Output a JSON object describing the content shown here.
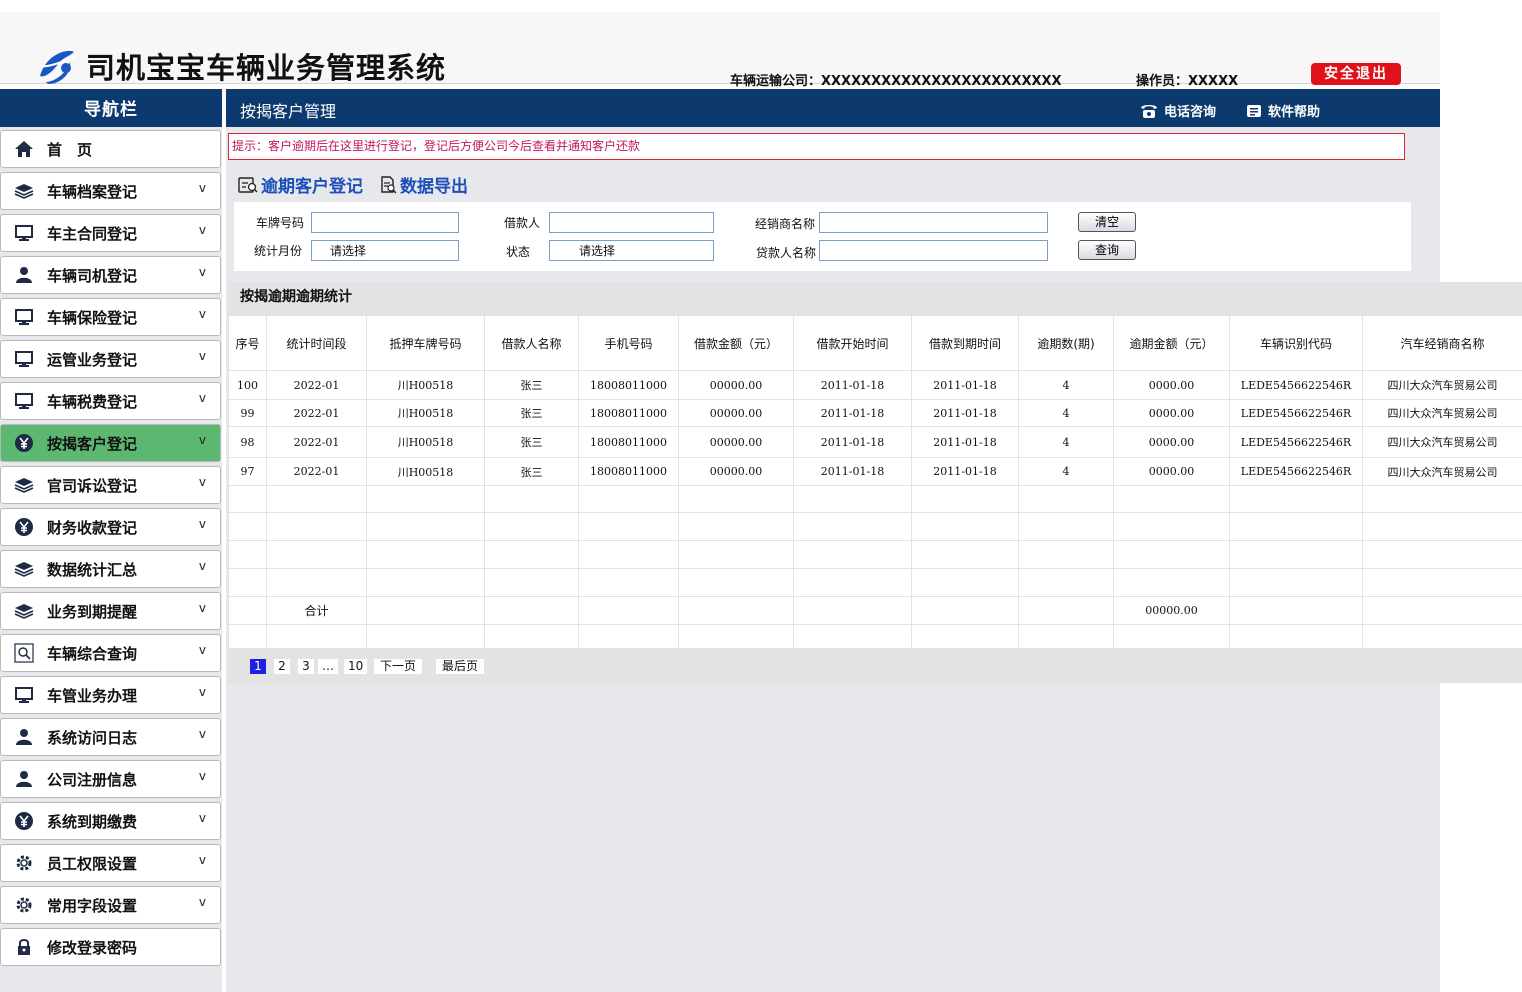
{
  "app": {
    "title": "司机宝宝车辆业务管理系统",
    "company": "车辆运输公司：XXXXXXXXXXXXXXXXXXXXXXXX",
    "operator": "操作员：XXXXX",
    "logout_label": "安全退出"
  },
  "sidebar": {
    "title": "导航栏",
    "items": [
      {
        "label": "首　页",
        "icon": "home-icon",
        "chevron": ""
      },
      {
        "label": "车辆档案登记",
        "icon": "layers-icon",
        "chevron": "v"
      },
      {
        "label": "车主合同登记",
        "icon": "monitor-icon",
        "chevron": "v"
      },
      {
        "label": "车辆司机登记",
        "icon": "user-icon",
        "chevron": "v"
      },
      {
        "label": "车辆保险登记",
        "icon": "monitor-icon",
        "chevron": "v"
      },
      {
        "label": "运管业务登记",
        "icon": "monitor-icon",
        "chevron": "v"
      },
      {
        "label": "车辆税费登记",
        "icon": "monitor-icon",
        "chevron": "v"
      },
      {
        "label": "按揭客户登记",
        "icon": "yen-icon",
        "chevron": "v"
      },
      {
        "label": "官司诉讼登记",
        "icon": "layers-icon",
        "chevron": "v"
      },
      {
        "label": "财务收款登记",
        "icon": "yen-icon",
        "chevron": "v"
      },
      {
        "label": "数据统计汇总",
        "icon": "layers-icon",
        "chevron": "v"
      },
      {
        "label": "业务到期提醒",
        "icon": "layers-icon",
        "chevron": "v"
      },
      {
        "label": "车辆综合查询",
        "icon": "search-icon",
        "chevron": "v"
      },
      {
        "label": "车管业务办理",
        "icon": "monitor-icon",
        "chevron": "v"
      },
      {
        "label": "系统访问日志",
        "icon": "user-icon",
        "chevron": "v"
      },
      {
        "label": "公司注册信息",
        "icon": "user-icon",
        "chevron": "v"
      },
      {
        "label": "系统到期缴费",
        "icon": "yen-icon",
        "chevron": "v"
      },
      {
        "label": "员工权限设置",
        "icon": "gear-icon",
        "chevron": "v"
      },
      {
        "label": "常用字段设置",
        "icon": "gear-icon",
        "chevron": "v"
      },
      {
        "label": "修改登录密码",
        "icon": "lock-icon",
        "chevron": ""
      }
    ],
    "active_index": 7,
    "active_color": "#5cb870"
  },
  "main": {
    "title": "按揭客户管理",
    "phone_label": "电话咨询",
    "help_label": "软件帮助",
    "hint": "提示：客户逾期后在这里进行登记，登记后方便公司今后查看并通知客户还款",
    "action_register": "逾期客户登记",
    "action_export": "数据导出"
  },
  "filter": {
    "plate_label": "车牌号码",
    "plate_value": "",
    "borrower_label": "借款人",
    "borrower_value": "",
    "dealer_label": "经销商名称",
    "dealer_value": "",
    "month_label": "统计月份",
    "month_value": "请选择",
    "status_label": "状态",
    "status_value": "请选择",
    "lender_label": "贷款人名称",
    "lender_value": "",
    "clear_label": "清空",
    "search_label": "查询"
  },
  "table": {
    "section_title": "按揭逾期逾期统计",
    "columns": [
      "序号",
      "统计时间段",
      "抵押车牌号码",
      "借款人名称",
      "手机号码",
      "借款金额（元）",
      "借款开始时间",
      "借款到期时间",
      "逾期数(期)",
      "逾期金额（元）",
      "车辆识别代码",
      "汽车经销商名称"
    ],
    "rows": [
      [
        "100",
        "2022-01",
        "川H00518",
        "张三",
        "18008011000",
        "00000.00",
        "2011-01-18",
        "2011-01-18",
        "4",
        "0000.00",
        "LEDE5456622546R",
        "四川大众汽车贸易公司"
      ],
      [
        "99",
        "2022-01",
        "川H00518",
        "张三",
        "18008011000",
        "00000.00",
        "2011-01-18",
        "2011-01-18",
        "4",
        "0000.00",
        "LEDE5456622546R",
        "四川大众汽车贸易公司"
      ],
      [
        "98",
        "2022-01",
        "川H00518",
        "张三",
        "18008011000",
        "00000.00",
        "2011-01-18",
        "2011-01-18",
        "4",
        "0000.00",
        "LEDE5456622546R",
        "四川大众汽车贸易公司"
      ],
      [
        "97",
        "2022-01",
        "川H00518",
        "张三",
        "18008011000",
        "00000.00",
        "2011-01-18",
        "2011-01-18",
        "4",
        "0000.00",
        "LEDE5456622546R",
        "四川大众汽车贸易公司"
      ],
      [
        "",
        "",
        "",
        "",
        "",
        "",
        "",
        "",
        "",
        "",
        "",
        ""
      ],
      [
        "",
        "",
        "",
        "",
        "",
        "",
        "",
        "",
        "",
        "",
        "",
        ""
      ],
      [
        "",
        "",
        "",
        "",
        "",
        "",
        "",
        "",
        "",
        "",
        "",
        ""
      ],
      [
        "",
        "",
        "",
        "",
        "",
        "",
        "",
        "",
        "",
        "",
        "",
        ""
      ],
      [
        "",
        "合计",
        "",
        "",
        "",
        "",
        "",
        "",
        "",
        "00000.00",
        "",
        ""
      ],
      [
        "",
        "",
        "",
        "",
        "",
        "",
        "",
        "",
        "",
        "",
        "",
        ""
      ]
    ]
  },
  "pager": {
    "pages": [
      "1",
      "2",
      "3",
      "…",
      "10"
    ],
    "current": "1",
    "next_label": "下一页",
    "last_label": "最后页"
  }
}
